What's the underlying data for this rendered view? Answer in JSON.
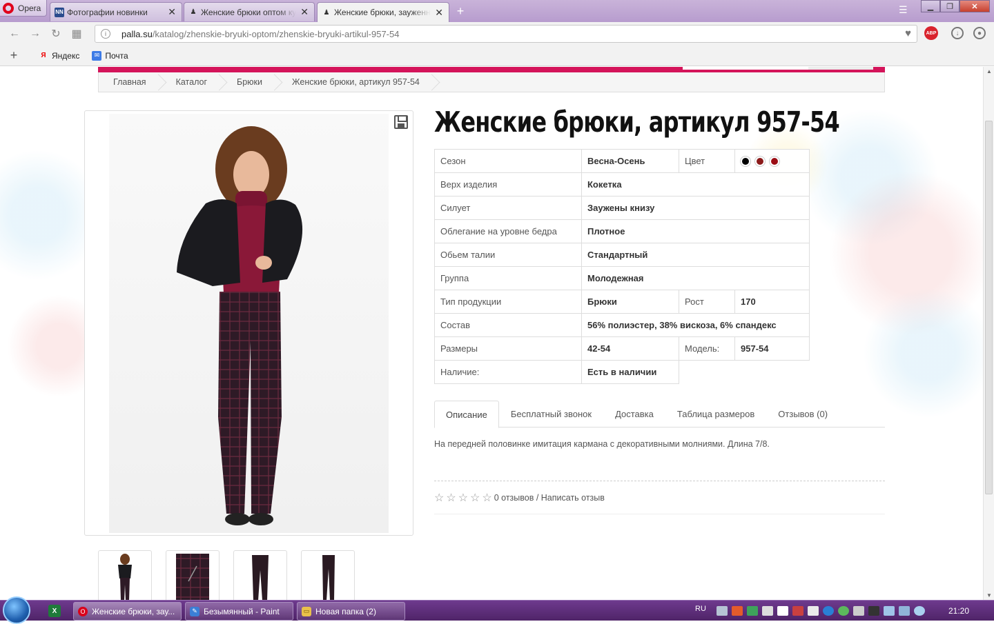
{
  "browser": {
    "menu_label": "Opera",
    "tabs": [
      {
        "icon": "NN",
        "title": "Фотографии новинки",
        "close": "✕"
      },
      {
        "icon": "♟",
        "title": "Женские брюки оптом кул",
        "close": "✕"
      },
      {
        "icon": "♟",
        "title": "Женские брюки, зауженн",
        "close": "✕"
      }
    ],
    "new_tab": "+",
    "url_host": "palla.su",
    "url_path": "/katalog/zhenskie-bryuki-optom/zhenskie-bryuki-artikul-957-54",
    "abp_label": "ABP",
    "bookmarks_add": "+",
    "bookmarks": [
      {
        "icon": "Я",
        "label": "Яндекс"
      },
      {
        "icon": "✉",
        "label": "Почта"
      }
    ]
  },
  "breadcrumb": [
    "Главная",
    "Каталог",
    "Брюки",
    "Женские брюки, артикул 957-54"
  ],
  "product": {
    "title": "Женские брюки, артикул 957-54",
    "attributes": {
      "season_label": "Сезон",
      "season": "Весна-Осень",
      "color_label": "Цвет",
      "colors": [
        "#000000",
        "#8b1a1a",
        "#9b0d14"
      ],
      "top_label": "Верх изделия",
      "top": "Кокетка",
      "silhouette_label": "Силует",
      "silhouette": "Заужены книзу",
      "hip_label": "Облегание на уровне бедра",
      "hip": "Плотное",
      "waist_label": "Обьем талии",
      "waist": "Стандартный",
      "group_label": "Группа",
      "group": "Молодежная",
      "type_label": "Тип продукции",
      "type": "Брюки",
      "height_label": "Рост",
      "height": "170",
      "composition_label": "Состав",
      "composition": "56% полиэстер, 38% вискоза, 6% спандекс",
      "sizes_label": "Размеры",
      "sizes": "42-54",
      "model_label": "Модель:",
      "model": "957-54",
      "availability_label": "Наличие:",
      "availability": "Есть в наличии"
    },
    "tabs": [
      "Описание",
      "Бесплатный звонок",
      "Доставка",
      "Таблица размеров",
      "Отзывов (0)"
    ],
    "description": "На передней половинке имитация кармана с декоративными молниями. Длина 7/8.",
    "reviews": {
      "count_text": "0 отзывов",
      "separator": " / ",
      "write_link": "Написать отзыв",
      "rating": 0,
      "max_rating": 5
    }
  },
  "taskbar": {
    "tasks": [
      {
        "title": "Женские брюки, зау...",
        "active": true
      },
      {
        "title": "Безымянный - Paint",
        "active": false
      },
      {
        "title": "Новая папка (2)",
        "active": false
      }
    ],
    "language": "RU",
    "time": "21:20"
  }
}
